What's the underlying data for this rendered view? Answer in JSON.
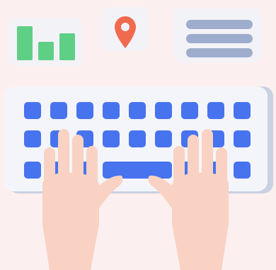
{
  "colors": {
    "background": "#fcefef",
    "card": "#f3f3f7",
    "chart_bars": "#5fcf86",
    "pin": "#f06a4f",
    "menu_lines": "#9eaccd",
    "keys": "#4773ef",
    "keyboard": "#f4f5fa",
    "skin": "#f9d2c3"
  },
  "icons": {
    "chart": "bar-chart-icon",
    "pin": "location-pin-icon",
    "menu": "menu-icon",
    "keyboard": "keyboard",
    "left_hand": "left-hand",
    "right_hand": "right-hand"
  },
  "chart_bars": [
    0.6,
    0.4,
    0.55
  ]
}
